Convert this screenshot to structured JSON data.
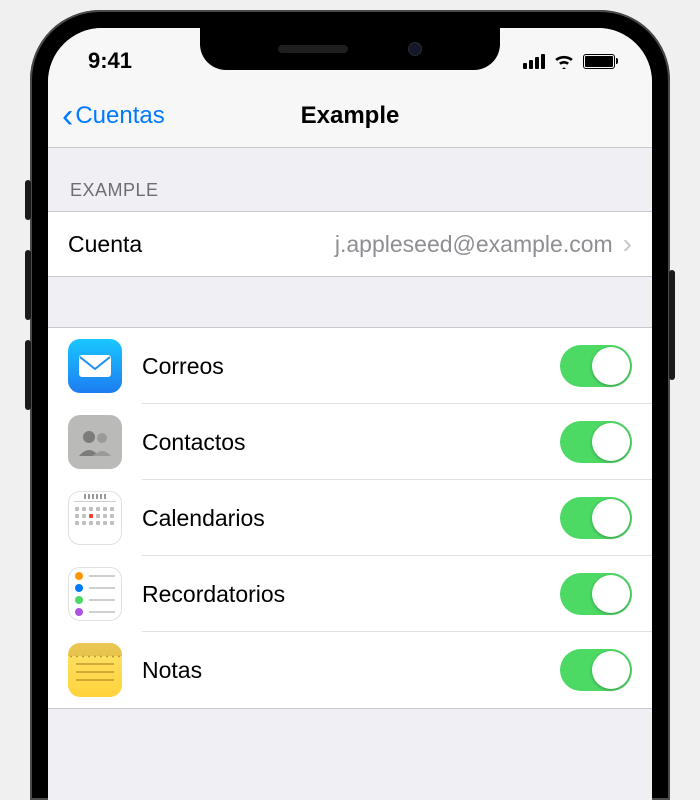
{
  "status": {
    "time": "9:41"
  },
  "nav": {
    "back_label": "Cuentas",
    "title": "Example"
  },
  "section_header": "EXAMPLE",
  "account": {
    "label": "Cuenta",
    "value": "j.appleseed@example.com"
  },
  "services": [
    {
      "key": "mail",
      "label": "Correos",
      "enabled": true
    },
    {
      "key": "contacts",
      "label": "Contactos",
      "enabled": true
    },
    {
      "key": "calendar",
      "label": "Calendarios",
      "enabled": true
    },
    {
      "key": "reminders",
      "label": "Recordatorios",
      "enabled": true
    },
    {
      "key": "notes",
      "label": "Notas",
      "enabled": true
    }
  ],
  "colors": {
    "accent": "#007aff",
    "toggle_on": "#4cd964",
    "background": "#efeff4"
  }
}
